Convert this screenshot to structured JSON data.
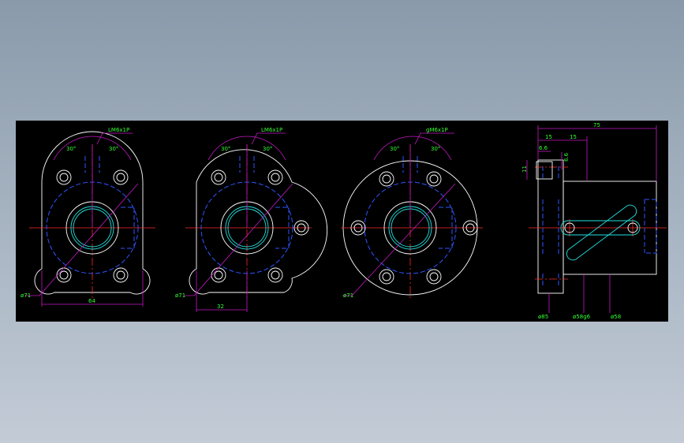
{
  "drawing": {
    "background": "#000000",
    "colors": {
      "outline": "#ffffff",
      "centerline": "#ff2a2a",
      "hidden": "#2e56ff",
      "thread": "#22e0e0",
      "dimension": "#c419c4",
      "text": "#33ff33"
    },
    "views": [
      {
        "name": "view-1",
        "angle_left": "30°",
        "angle_right": "30°",
        "thread_label": "LM6x1P",
        "diameter": "ø71",
        "width_dim": "64"
      },
      {
        "name": "view-2",
        "angle_left": "30°",
        "angle_right": "30°",
        "thread_label": "LM6x1P",
        "diameter": "ø71",
        "offset_dim": "32"
      },
      {
        "name": "view-3",
        "angle_left": "30°",
        "angle_right": "30°",
        "thread_label": "gM6x1P",
        "diameter": "ø71"
      },
      {
        "name": "side-view",
        "total_length": "75",
        "seg1": "15",
        "seg2": "15",
        "small1": "6.6",
        "small2": "6.6",
        "height_small": "11",
        "dia1": "ø85",
        "dia2": "ø58g6",
        "dia3": "ø58"
      }
    ]
  }
}
